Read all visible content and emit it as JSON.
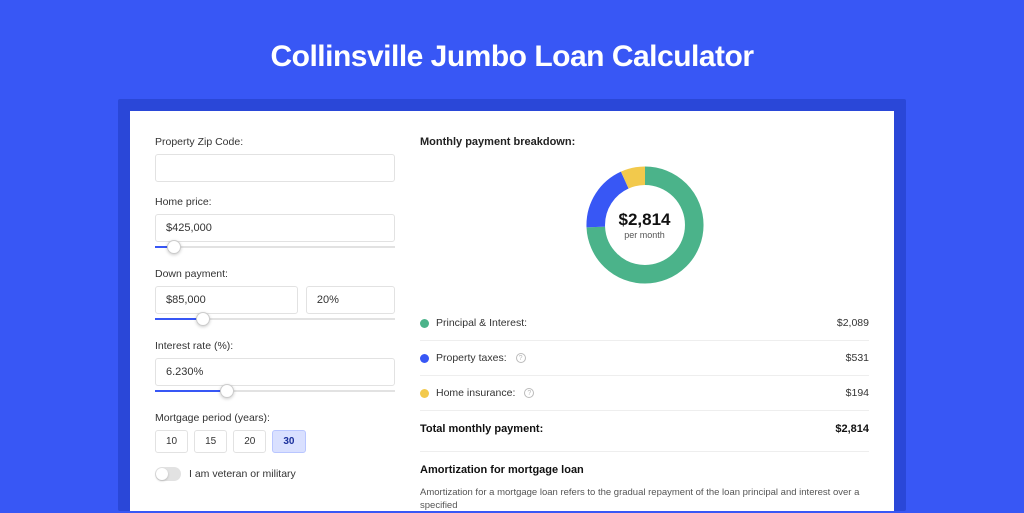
{
  "title": "Collinsville Jumbo Loan Calculator",
  "colors": {
    "primary": "#3857f5",
    "green": "#4bb38a",
    "yellow": "#f2c94c"
  },
  "form": {
    "zip": {
      "label": "Property Zip Code:",
      "value": ""
    },
    "price": {
      "label": "Home price:",
      "value": "$425,000",
      "slider_pct": 8
    },
    "down": {
      "label": "Down payment:",
      "value": "$85,000",
      "pct": "20%",
      "slider_pct": 20
    },
    "rate": {
      "label": "Interest rate (%):",
      "value": "6.230%",
      "slider_pct": 30
    },
    "period": {
      "label": "Mortgage period (years):",
      "options": [
        "10",
        "15",
        "20",
        "30"
      ],
      "selected": "30"
    },
    "veteran_label": "I am veteran or military",
    "veteran_on": false
  },
  "breakdown": {
    "title": "Monthly payment breakdown:",
    "total_amount": "$2,814",
    "per_month": "per month",
    "items": [
      {
        "label": "Principal & Interest:",
        "value": "$2,089",
        "color": "green",
        "info": false
      },
      {
        "label": "Property taxes:",
        "value": "$531",
        "color": "blue",
        "info": true
      },
      {
        "label": "Home insurance:",
        "value": "$194",
        "color": "yellow",
        "info": true
      }
    ],
    "total_label": "Total monthly payment:",
    "total_value": "$2,814"
  },
  "amortization": {
    "title": "Amortization for mortgage loan",
    "text": "Amortization for a mortgage loan refers to the gradual repayment of the loan principal and interest over a specified"
  },
  "chart_data": {
    "type": "pie",
    "title": "Monthly payment breakdown",
    "series": [
      {
        "name": "Principal & Interest",
        "value": 2089,
        "color": "#4bb38a"
      },
      {
        "name": "Property taxes",
        "value": 531,
        "color": "#3857f5"
      },
      {
        "name": "Home insurance",
        "value": 194,
        "color": "#f2c94c"
      }
    ],
    "total": 2814,
    "center_label": "$2,814 per month"
  }
}
